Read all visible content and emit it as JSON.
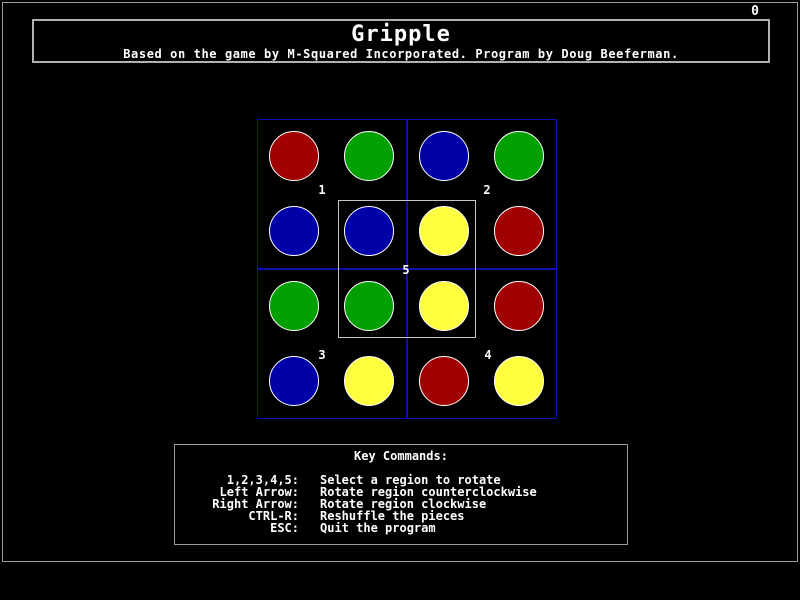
{
  "score": "0",
  "header": {
    "title": "Gripple",
    "subtitle": "Based on the game by M-Squared Incorporated.  Program by Doug Beeferman."
  },
  "colors": {
    "red": "#a00000",
    "green": "#00a000",
    "blue": "#0000a8",
    "yellow": "#ffff40",
    "region_border": "#1010b0",
    "selected_region_border": "#c8c8c8"
  },
  "board": {
    "rows": [
      [
        "red",
        "green",
        "blue",
        "green"
      ],
      [
        "blue",
        "blue",
        "yellow",
        "red"
      ],
      [
        "green",
        "green",
        "yellow",
        "red"
      ],
      [
        "blue",
        "yellow",
        "red",
        "yellow"
      ]
    ],
    "region_labels": [
      "1",
      "2",
      "3",
      "4",
      "5"
    ],
    "selected_region": "5"
  },
  "key_commands": {
    "title": "Key Commands:",
    "items": [
      {
        "key": "1,2,3,4,5:",
        "desc": "Select a region to rotate"
      },
      {
        "key": "Left Arrow:",
        "desc": "Rotate region counterclockwise"
      },
      {
        "key": "Right Arrow:",
        "desc": "Rotate region clockwise"
      },
      {
        "key": "CTRL-R:",
        "desc": "Reshuffle the pieces"
      },
      {
        "key": "ESC:",
        "desc": "Quit the program"
      }
    ]
  }
}
